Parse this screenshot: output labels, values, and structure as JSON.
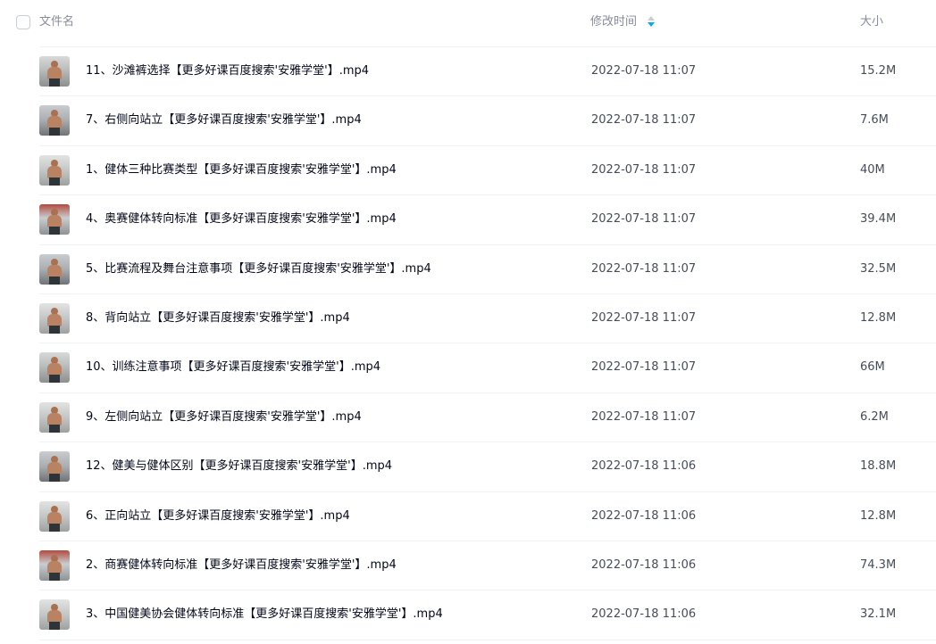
{
  "header": {
    "name_label": "文件名",
    "time_label": "修改时间",
    "size_label": "大小"
  },
  "colors": {
    "accent": "#06a7ff",
    "text_primary": "#03081a",
    "text_secondary": "#454d5a",
    "header_text": "#878c9c",
    "divider": "#f1f2f4"
  },
  "files": [
    {
      "name": "11、沙滩裤选择【更多好课百度搜索'安雅学堂'】.mp4",
      "time": "2022-07-18 11:07",
      "size": "15.2M",
      "thumb_icon": "video-thumbnail-icon"
    },
    {
      "name": "7、右侧向站立【更多好课百度搜索'安雅学堂'】.mp4",
      "time": "2022-07-18 11:07",
      "size": "7.6M",
      "thumb_icon": "video-thumbnail-icon"
    },
    {
      "name": "1、健体三种比赛类型【更多好课百度搜索'安雅学堂'】.mp4",
      "time": "2022-07-18 11:07",
      "size": "40M",
      "thumb_icon": "video-thumbnail-icon"
    },
    {
      "name": "4、奥赛健体转向标准【更多好课百度搜索'安雅学堂'】.mp4",
      "time": "2022-07-18 11:07",
      "size": "39.4M",
      "thumb_icon": "video-thumbnail-icon"
    },
    {
      "name": "5、比赛流程及舞台注意事项【更多好课百度搜索'安雅学堂'】.mp4",
      "time": "2022-07-18 11:07",
      "size": "32.5M",
      "thumb_icon": "video-thumbnail-icon"
    },
    {
      "name": "8、背向站立【更多好课百度搜索'安雅学堂'】.mp4",
      "time": "2022-07-18 11:07",
      "size": "12.8M",
      "thumb_icon": "video-thumbnail-icon"
    },
    {
      "name": "10、训练注意事项【更多好课百度搜索'安雅学堂'】.mp4",
      "time": "2022-07-18 11:07",
      "size": "66M",
      "thumb_icon": "video-thumbnail-icon"
    },
    {
      "name": "9、左侧向站立【更多好课百度搜索'安雅学堂'】.mp4",
      "time": "2022-07-18 11:07",
      "size": "6.2M",
      "thumb_icon": "video-thumbnail-icon"
    },
    {
      "name": "12、健美与健体区别【更多好课百度搜索'安雅学堂'】.mp4",
      "time": "2022-07-18 11:06",
      "size": "18.8M",
      "thumb_icon": "video-thumbnail-icon"
    },
    {
      "name": "6、正向站立【更多好课百度搜索'安雅学堂'】.mp4",
      "time": "2022-07-18 11:06",
      "size": "12.8M",
      "thumb_icon": "video-thumbnail-icon"
    },
    {
      "name": "2、商赛健体转向标准【更多好课百度搜索'安雅学堂'】.mp4",
      "time": "2022-07-18 11:06",
      "size": "74.3M",
      "thumb_icon": "video-thumbnail-icon"
    },
    {
      "name": "3、中国健美协会健体转向标准【更多好课百度搜索'安雅学堂'】.mp4",
      "time": "2022-07-18 11:06",
      "size": "32.1M",
      "thumb_icon": "video-thumbnail-icon"
    }
  ]
}
